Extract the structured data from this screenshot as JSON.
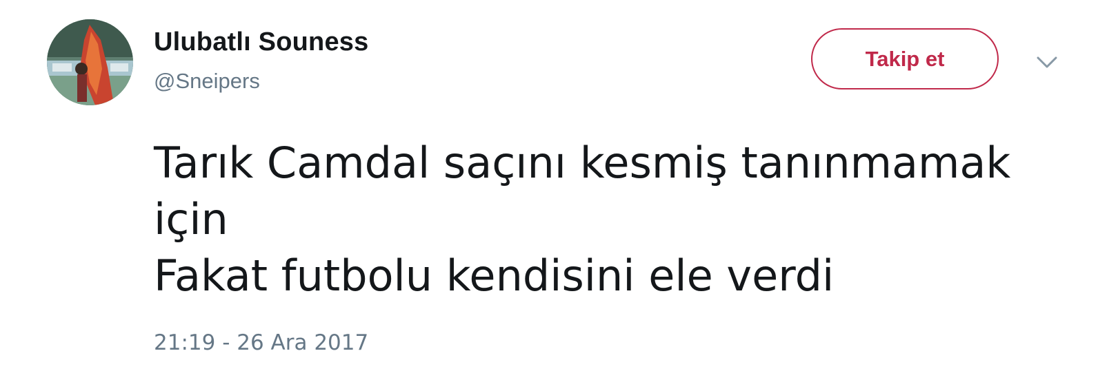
{
  "tweet": {
    "author": {
      "display_name": "Ulubatlı Souness",
      "handle": "@Sneipers",
      "avatar_icon": "avatar-photo"
    },
    "follow_button_label": "Takip et",
    "menu_icon": "chevron-down-icon",
    "text_lines": [
      "Tarık Camdal saçını kesmiş tanınmamak",
      "için",
      "Fakat futbolu kendisini ele verdi"
    ],
    "timestamp": "21:19 - 26 Ara 2017"
  },
  "colors": {
    "accent": "#c0294a",
    "text": "#14171a",
    "muted": "#657786"
  }
}
